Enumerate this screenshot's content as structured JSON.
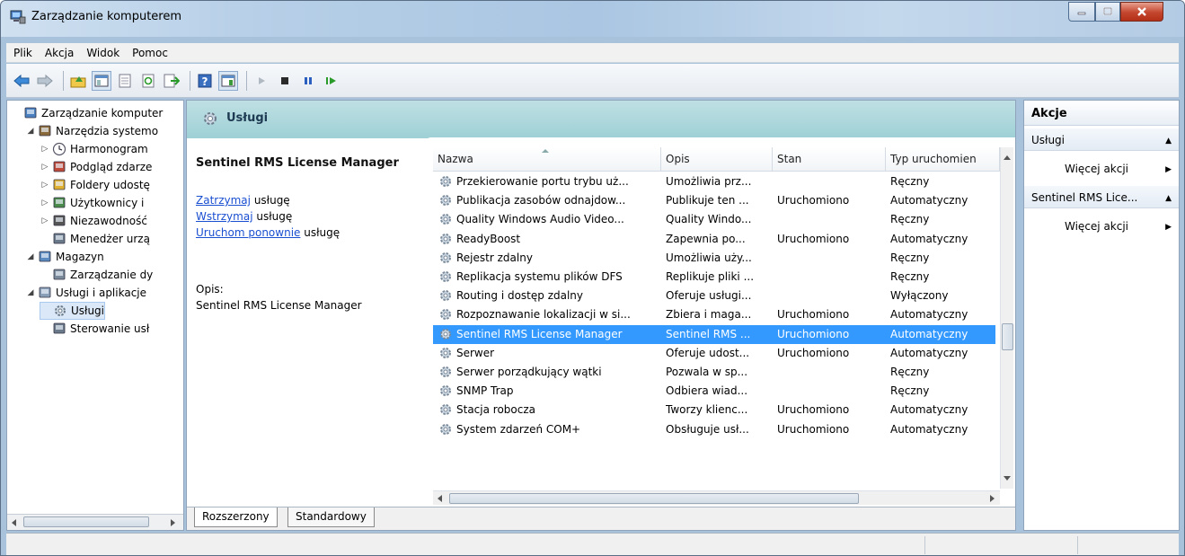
{
  "window": {
    "title": "Zarządzanie komputerem"
  },
  "menu": [
    {
      "label": "Plik"
    },
    {
      "label": "Akcja"
    },
    {
      "label": "Widok"
    },
    {
      "label": "Pomoc"
    }
  ],
  "toolbar": {
    "icons": [
      "back-arrow-icon",
      "forward-arrow-icon",
      "up-folder-icon",
      "show-hide-tree-icon",
      "properties-icon",
      "refresh-icon",
      "export-list-icon",
      "help-icon",
      "show-hide-action-pane-icon",
      "play-icon",
      "stop-icon",
      "pause-icon",
      "resume-icon"
    ]
  },
  "tree": {
    "items": [
      {
        "label": "Zarządzanie komputer",
        "level": 0,
        "expander": "",
        "icon": "computer-icon"
      },
      {
        "label": "Narzędzia systemo",
        "level": 1,
        "expander": "◢",
        "icon": "tools-icon"
      },
      {
        "label": "Harmonogram",
        "level": 2,
        "expander": "▷",
        "icon": "clock-icon"
      },
      {
        "label": "Podgląd zdarze",
        "level": 2,
        "expander": "▷",
        "icon": "event-viewer-icon"
      },
      {
        "label": "Foldery udostę",
        "level": 2,
        "expander": "▷",
        "icon": "shared-folder-icon"
      },
      {
        "label": "Użytkownicy i",
        "level": 2,
        "expander": "▷",
        "icon": "users-icon"
      },
      {
        "label": "Niezawodność",
        "level": 2,
        "expander": "▷",
        "icon": "reliability-icon"
      },
      {
        "label": "Menedżer urzą",
        "level": 2,
        "expander": "",
        "icon": "device-manager-icon"
      },
      {
        "label": "Magazyn",
        "level": 1,
        "expander": "◢",
        "icon": "storage-icon"
      },
      {
        "label": "Zarządzanie dy",
        "level": 2,
        "expander": "",
        "icon": "disk-management-icon"
      },
      {
        "label": "Usługi i aplikacje",
        "level": 1,
        "expander": "◢",
        "icon": "services-apps-icon"
      },
      {
        "label": "Usługi",
        "level": 2,
        "expander": "",
        "icon": "services-gear-icon",
        "selected": true
      },
      {
        "label": "Sterowanie usł",
        "level": 2,
        "expander": "",
        "icon": "wmi-control-icon"
      }
    ]
  },
  "center": {
    "header_title": "Usługi",
    "selected_service": "Sentinel RMS License Manager",
    "links": [
      {
        "link": "Zatrzymaj",
        "rest": " usługę"
      },
      {
        "link": "Wstrzymaj",
        "rest": " usługę"
      },
      {
        "link": "Uruchom ponownie",
        "rest": " usługę"
      }
    ],
    "desc_label": "Opis:",
    "desc_value": "Sentinel RMS License Manager"
  },
  "table": {
    "columns": [
      "Nazwa",
      "Opis",
      "Stan",
      "Typ uruchomien"
    ],
    "rows": [
      {
        "name": "Przekierowanie portu trybu uż...",
        "desc": "Umożliwia prz...",
        "state": "",
        "type": "Ręczny"
      },
      {
        "name": "Publikacja zasobów odnajdow...",
        "desc": "Publikuje ten ...",
        "state": "Uruchomiono",
        "type": "Automatyczny"
      },
      {
        "name": "Quality Windows Audio Video...",
        "desc": "Quality Windo...",
        "state": "",
        "type": "Ręczny"
      },
      {
        "name": "ReadyBoost",
        "desc": "Zapewnia po...",
        "state": "Uruchomiono",
        "type": "Automatyczny"
      },
      {
        "name": "Rejestr zdalny",
        "desc": "Umożliwia uży...",
        "state": "",
        "type": "Ręczny"
      },
      {
        "name": "Replikacja systemu plików DFS",
        "desc": "Replikuje pliki ...",
        "state": "",
        "type": "Ręczny"
      },
      {
        "name": "Routing i dostęp zdalny",
        "desc": "Oferuje usługi...",
        "state": "",
        "type": "Wyłączony"
      },
      {
        "name": "Rozpoznawanie lokalizacji w si...",
        "desc": "Zbiera i maga...",
        "state": "Uruchomiono",
        "type": "Automatyczny"
      },
      {
        "name": "Sentinel RMS License Manager",
        "desc": "Sentinel RMS ...",
        "state": "Uruchomiono",
        "type": "Automatyczny",
        "selected": true
      },
      {
        "name": "Serwer",
        "desc": "Oferuje udost...",
        "state": "Uruchomiono",
        "type": "Automatyczny"
      },
      {
        "name": "Serwer porządkujący wątki",
        "desc": "Pozwala w sp...",
        "state": "",
        "type": "Ręczny"
      },
      {
        "name": "SNMP Trap",
        "desc": "Odbiera wiad...",
        "state": "",
        "type": "Ręczny"
      },
      {
        "name": "Stacja robocza",
        "desc": "Tworzy klienc...",
        "state": "Uruchomiono",
        "type": "Automatyczny"
      },
      {
        "name": "System zdarzeń COM+",
        "desc": "Obsługuje usł...",
        "state": "Uruchomiono",
        "type": "Automatyczny"
      }
    ]
  },
  "bottom_tabs": {
    "extended": "Rozszerzony",
    "standard": "Standardowy"
  },
  "actions": {
    "header": "Akcje",
    "section1": "Usługi",
    "more1": "Więcej akcji",
    "section2": "Sentinel RMS Lice...",
    "more2": "Więcej akcji"
  },
  "colors": {
    "selection": "#3399ff",
    "link": "#1a4fd1",
    "header_teal": "#9ed0d5"
  }
}
